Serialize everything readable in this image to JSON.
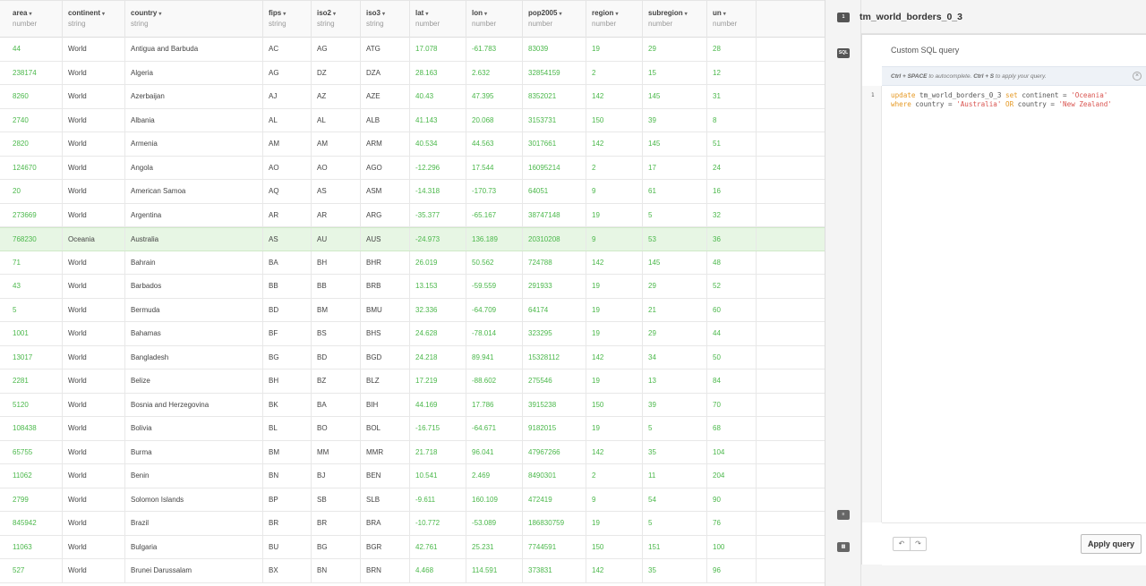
{
  "columns": [
    {
      "name": "area",
      "type": "number"
    },
    {
      "name": "continent",
      "type": "string"
    },
    {
      "name": "country",
      "type": "string"
    },
    {
      "name": "fips",
      "type": "string"
    },
    {
      "name": "iso2",
      "type": "string"
    },
    {
      "name": "iso3",
      "type": "string"
    },
    {
      "name": "lat",
      "type": "number"
    },
    {
      "name": "lon",
      "type": "number"
    },
    {
      "name": "pop2005",
      "type": "number"
    },
    {
      "name": "region",
      "type": "number"
    },
    {
      "name": "subregion",
      "type": "number"
    },
    {
      "name": "un",
      "type": "number"
    }
  ],
  "rows": [
    [
      "44",
      "World",
      "Antigua and Barbuda",
      "AC",
      "AG",
      "ATG",
      "17.078",
      "-61.783",
      "83039",
      "19",
      "29",
      "28"
    ],
    [
      "238174",
      "World",
      "Algeria",
      "AG",
      "DZ",
      "DZA",
      "28.163",
      "2.632",
      "32854159",
      "2",
      "15",
      "12"
    ],
    [
      "8260",
      "World",
      "Azerbaijan",
      "AJ",
      "AZ",
      "AZE",
      "40.43",
      "47.395",
      "8352021",
      "142",
      "145",
      "31"
    ],
    [
      "2740",
      "World",
      "Albania",
      "AL",
      "AL",
      "ALB",
      "41.143",
      "20.068",
      "3153731",
      "150",
      "39",
      "8"
    ],
    [
      "2820",
      "World",
      "Armenia",
      "AM",
      "AM",
      "ARM",
      "40.534",
      "44.563",
      "3017661",
      "142",
      "145",
      "51"
    ],
    [
      "124670",
      "World",
      "Angola",
      "AO",
      "AO",
      "AGO",
      "-12.296",
      "17.544",
      "16095214",
      "2",
      "17",
      "24"
    ],
    [
      "20",
      "World",
      "American Samoa",
      "AQ",
      "AS",
      "ASM",
      "-14.318",
      "-170.73",
      "64051",
      "9",
      "61",
      "16"
    ],
    [
      "273669",
      "World",
      "Argentina",
      "AR",
      "AR",
      "ARG",
      "-35.377",
      "-65.167",
      "38747148",
      "19",
      "5",
      "32"
    ],
    [
      "768230",
      "Oceania",
      "Australia",
      "AS",
      "AU",
      "AUS",
      "-24.973",
      "136.189",
      "20310208",
      "9",
      "53",
      "36"
    ],
    [
      "71",
      "World",
      "Bahrain",
      "BA",
      "BH",
      "BHR",
      "26.019",
      "50.562",
      "724788",
      "142",
      "145",
      "48"
    ],
    [
      "43",
      "World",
      "Barbados",
      "BB",
      "BB",
      "BRB",
      "13.153",
      "-59.559",
      "291933",
      "19",
      "29",
      "52"
    ],
    [
      "5",
      "World",
      "Bermuda",
      "BD",
      "BM",
      "BMU",
      "32.336",
      "-64.709",
      "64174",
      "19",
      "21",
      "60"
    ],
    [
      "1001",
      "World",
      "Bahamas",
      "BF",
      "BS",
      "BHS",
      "24.628",
      "-78.014",
      "323295",
      "19",
      "29",
      "44"
    ],
    [
      "13017",
      "World",
      "Bangladesh",
      "BG",
      "BD",
      "BGD",
      "24.218",
      "89.941",
      "15328112",
      "142",
      "34",
      "50"
    ],
    [
      "2281",
      "World",
      "Belize",
      "BH",
      "BZ",
      "BLZ",
      "17.219",
      "-88.602",
      "275546",
      "19",
      "13",
      "84"
    ],
    [
      "5120",
      "World",
      "Bosnia and Herzegovina",
      "BK",
      "BA",
      "BIH",
      "44.169",
      "17.786",
      "3915238",
      "150",
      "39",
      "70"
    ],
    [
      "108438",
      "World",
      "Bolivia",
      "BL",
      "BO",
      "BOL",
      "-16.715",
      "-64.671",
      "9182015",
      "19",
      "5",
      "68"
    ],
    [
      "65755",
      "World",
      "Burma",
      "BM",
      "MM",
      "MMR",
      "21.718",
      "96.041",
      "47967266",
      "142",
      "35",
      "104"
    ],
    [
      "11062",
      "World",
      "Benin",
      "BN",
      "BJ",
      "BEN",
      "10.541",
      "2.469",
      "8490301",
      "2",
      "11",
      "204"
    ],
    [
      "2799",
      "World",
      "Solomon Islands",
      "BP",
      "SB",
      "SLB",
      "-9.611",
      "160.109",
      "472419",
      "9",
      "54",
      "90"
    ],
    [
      "845942",
      "World",
      "Brazil",
      "BR",
      "BR",
      "BRA",
      "-10.772",
      "-53.089",
      "186830759",
      "19",
      "5",
      "76"
    ],
    [
      "11063",
      "World",
      "Bulgaria",
      "BU",
      "BG",
      "BGR",
      "42.761",
      "25.231",
      "7744591",
      "150",
      "151",
      "100"
    ],
    [
      "527",
      "World",
      "Brunei Darussalam",
      "BX",
      "BN",
      "BRN",
      "4.468",
      "114.591",
      "373831",
      "142",
      "35",
      "96"
    ]
  ],
  "highlighted_row": 8,
  "panel": {
    "title": "tm_world_borders_0_3",
    "rail": {
      "top_icon": "info-icon",
      "sql_label": "SQL",
      "bottom_icons": [
        "legend-icon",
        "map-icon"
      ]
    },
    "editor": {
      "card_title": "Custom SQL query",
      "hint_key1": "Ctrl + SPACE",
      "hint_mid": " to autocomplete. ",
      "hint_key2": "Ctrl + S",
      "hint_end": " to apply your query.",
      "line_number": "1",
      "code_line1": "update tm_world_borders_0_3 set continent = 'Oceania'",
      "code_line2": "where country = 'Australia' OR country = 'New Zealand'"
    },
    "undo_label": "↶",
    "redo_label": "↷",
    "apply_label": "Apply query"
  },
  "colors": {
    "number": "#4bb84b",
    "highlight": "#e7f6e4",
    "keyword": "#e69a26",
    "string_value": "#d9534f"
  }
}
